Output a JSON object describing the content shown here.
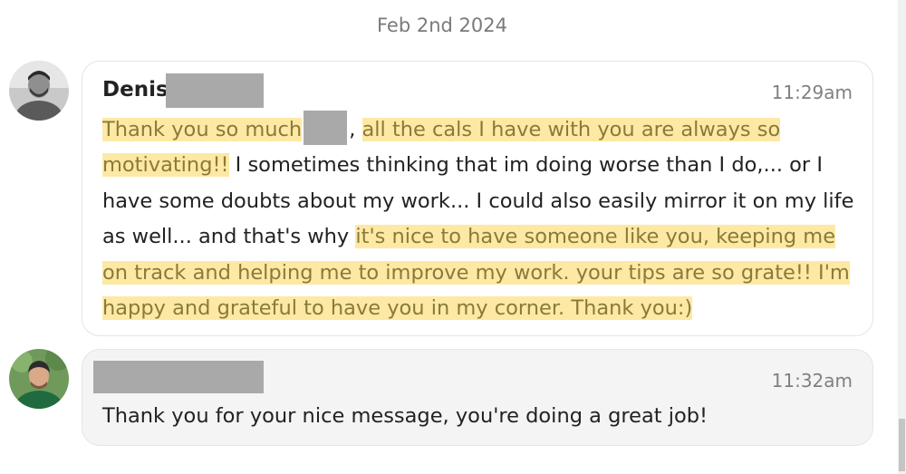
{
  "date_divider": "Feb 2nd 2024",
  "messages": [
    {
      "sender": "Denis",
      "time": "11:29am",
      "segments": [
        {
          "t": "Thank you so much",
          "hl": true
        },
        {
          "t": "",
          "redacted": true
        },
        {
          "t": ", ",
          "hl": false
        },
        {
          "t": "all the cals I have with you are always so motivating!!",
          "hl": true
        },
        {
          "t": " I sometimes thinking that im doing worse than I do,... or I have some doubts about my work... I could also easily mirror it on my life as well... and that's why ",
          "hl": false
        },
        {
          "t": "it's nice to have someone like you, keeping me on track and helping me to improve my work. your tips are so grate!! I'm happy and grateful to have you in my corner. Thank you:)",
          "hl": true
        }
      ]
    },
    {
      "sender": "",
      "time": "11:32am",
      "text": "Thank you for your nice message, you're doing a great job!"
    }
  ],
  "colors": {
    "highlight": "#fde9a3",
    "highlight_text": "#8a7a3a",
    "redaction": "#a9a9a9"
  }
}
